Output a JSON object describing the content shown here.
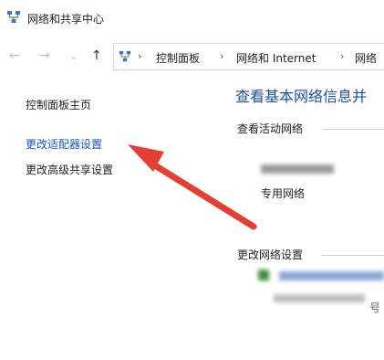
{
  "window": {
    "title": "网络和共享中心",
    "icon": "network-center-icon"
  },
  "navigation": {
    "back": "←",
    "forward": "→",
    "recent": "⌄",
    "up": "↑"
  },
  "breadcrumb": [
    {
      "label": "控制面板"
    },
    {
      "label": "网络和 Internet"
    },
    {
      "label": "网络"
    }
  ],
  "breadcrumb_separator": "›",
  "sidebar": {
    "home": "控制面板主页",
    "adapter_settings": "更改适配器设置",
    "advanced_sharing": "更改高级共享设置"
  },
  "main": {
    "heading": "查看基本网络信息并",
    "active_networks_label": "查看活动网络",
    "network_type": "专用网络",
    "change_settings_label": "更改网络设置",
    "setup_hint_tail": "号"
  },
  "colors": {
    "link": "#1a55c4",
    "heading": "#1e4e9c",
    "arrow": "#e33f33"
  }
}
